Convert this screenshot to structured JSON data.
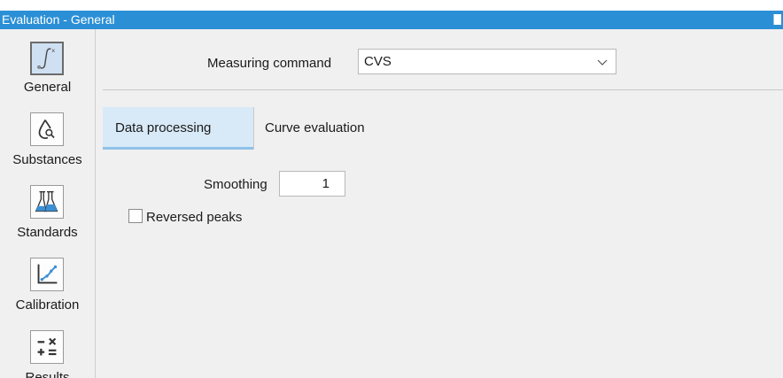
{
  "window": {
    "title": "Evaluation - General"
  },
  "sidebar": {
    "items": [
      {
        "label": "General",
        "icon": "integral-icon",
        "active": true
      },
      {
        "label": "Substances",
        "icon": "drop-search-icon",
        "active": false
      },
      {
        "label": "Standards",
        "icon": "flasks-icon",
        "active": false
      },
      {
        "label": "Calibration",
        "icon": "calibration-curve-icon",
        "active": false
      },
      {
        "label": "Results",
        "icon": "calculator-icon",
        "active": false
      }
    ]
  },
  "main": {
    "measuring_command": {
      "label": "Measuring command",
      "value": "CVS"
    },
    "tabs": [
      {
        "label": "Data processing",
        "active": true
      },
      {
        "label": "Curve evaluation",
        "active": false
      }
    ],
    "smoothing": {
      "label": "Smoothing",
      "value": "1"
    },
    "reversed_peaks": {
      "label": "Reversed peaks",
      "checked": false
    }
  },
  "colors": {
    "titlebar": "#2b8fd6",
    "active_tab": "#d8e9f7",
    "accent": "#3c8fd4"
  }
}
